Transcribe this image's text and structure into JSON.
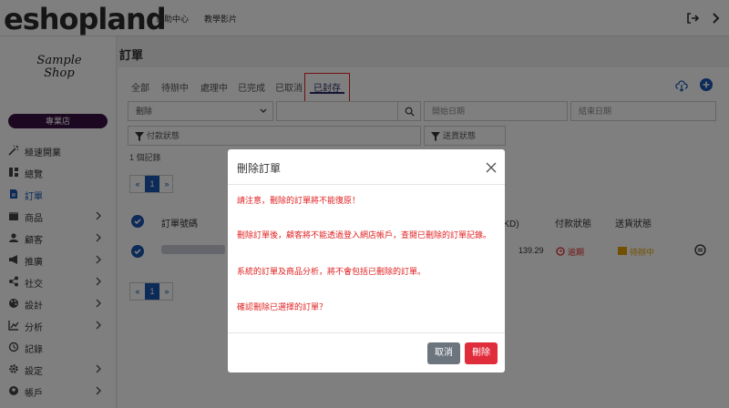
{
  "brand": {
    "logo": "eshopland"
  },
  "topbar": {
    "help_center": "幫助中心",
    "tutorial_videos": "教學影片"
  },
  "sidebar": {
    "shop_name": "Sample Shop",
    "plan_badge": "專業店",
    "items": [
      {
        "label": "極速開業",
        "icon": "magic-wand-icon",
        "chevron": false
      },
      {
        "label": "總覽",
        "icon": "dashboard-icon",
        "chevron": false
      },
      {
        "label": "訂單",
        "icon": "document-icon",
        "chevron": false,
        "active": true
      },
      {
        "label": "商品",
        "icon": "box-icon",
        "chevron": true
      },
      {
        "label": "顧客",
        "icon": "user-icon",
        "chevron": true
      },
      {
        "label": "推廣",
        "icon": "megaphone-icon",
        "chevron": true
      },
      {
        "label": "社交",
        "icon": "share-icon",
        "chevron": true
      },
      {
        "label": "設計",
        "icon": "palette-icon",
        "chevron": true
      },
      {
        "label": "分析",
        "icon": "chart-icon",
        "chevron": true
      },
      {
        "label": "記錄",
        "icon": "history-icon",
        "chevron": false
      },
      {
        "label": "設定",
        "icon": "gear-icon",
        "chevron": true
      },
      {
        "label": "帳戶",
        "icon": "account-icon",
        "chevron": true
      }
    ]
  },
  "main": {
    "title": "訂單",
    "tabs": [
      {
        "label": "全部"
      },
      {
        "label": "待辦中"
      },
      {
        "label": "處理中"
      },
      {
        "label": "已完成"
      },
      {
        "label": "已取消"
      },
      {
        "label": "已封存",
        "active": true
      }
    ],
    "filters": {
      "action_select": "刪除",
      "search_value": "",
      "start_date_placeholder": "開始日期",
      "end_date_placeholder": "結束日期",
      "payment_status": "付款狀態",
      "shipping_status": "送貨狀態"
    },
    "record_count": "1 個記錄",
    "pagination": {
      "prev": "«",
      "current": "1",
      "next": "»"
    },
    "table": {
      "col_order_no": "訂單號碼",
      "col_total": "總計 (HKD)",
      "col_payment": "付款狀態",
      "col_shipping": "送貨狀態",
      "row": {
        "total": "139.29",
        "payment": "逾期",
        "shipping": "待辦中"
      }
    }
  },
  "modal": {
    "title": "刪除訂單",
    "line1": "請注意，刪除的訂單將不能復原！",
    "line2": "刪除訂單後，顧客將不能透過登入網店帳戶，查閱已刪除的訂單記錄。",
    "line3": "系統的訂單及商品分析，將不會包括已刪除的訂單。",
    "line4": "確認刪除已選擇的訂單？",
    "cancel_label": "取消",
    "delete_label": "刪除"
  },
  "colors": {
    "accent_blue": "#1a56b0",
    "danger_red": "#e02d3c",
    "warning_text": "#e02020",
    "cancel_gray": "#6c757d",
    "plan_badge": "#3a1145"
  }
}
